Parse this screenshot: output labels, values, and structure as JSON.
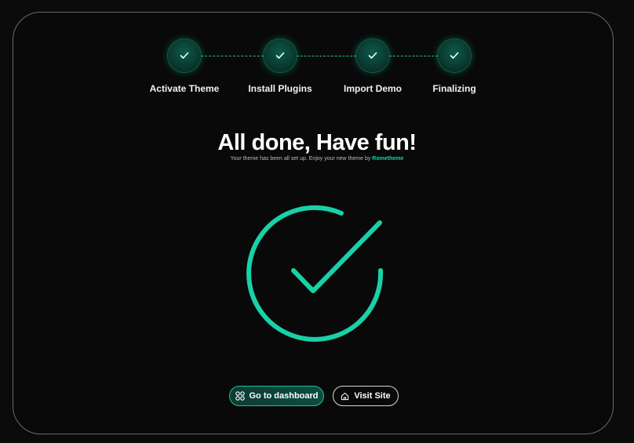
{
  "steps": [
    {
      "label": "Activate Theme",
      "status": "done"
    },
    {
      "label": "Install Plugins",
      "status": "done"
    },
    {
      "label": "Import Demo",
      "status": "done"
    },
    {
      "label": "Finalizing",
      "status": "done"
    }
  ],
  "heading": {
    "title": "All done, Have fun!",
    "subtitle_text": "Your theme has been all set up. Enjoy your new theme by ",
    "brand": "Rometheme"
  },
  "actions": {
    "dashboard_label": "Go to dashboard",
    "visit_label": "Visit Site"
  },
  "icons": {
    "step": "check-icon",
    "success": "check-circle-icon",
    "dashboard": "grid-icon",
    "visit": "home-icon"
  },
  "colors": {
    "accent": "#19d1a6",
    "background": "#090909",
    "text": "#ffffff"
  }
}
